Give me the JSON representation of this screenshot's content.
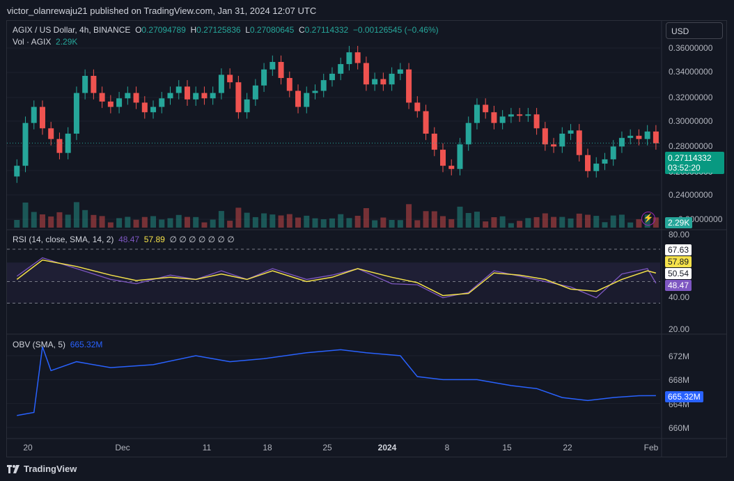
{
  "header": {
    "published": "victor_olanrewaju21 published on TradingView.com, Jan 31, 2024 12:07 UTC"
  },
  "price_legend": {
    "symbol": "AGIX / US Dollar, 4h, BINANCE",
    "o_label": "O",
    "o": "0.27094789",
    "h_label": "H",
    "h": "0.27125836",
    "l_label": "L",
    "l": "0.27080645",
    "c_label": "C",
    "c": "0.27114332",
    "change": "−0.00126545 (−0.46%)",
    "vol_label": "Vol · AGIX",
    "vol": "2.29K"
  },
  "currency": "USD",
  "price_axis": [
    "0.36000000",
    "0.34000000",
    "0.32000000",
    "0.30000000",
    "0.28000000",
    "0.24000000",
    "0.20000000"
  ],
  "price_axis_partial": "0.26000000",
  "last_price": "0.27114332",
  "countdown": "03:52:20",
  "vol_tag": "2.29K",
  "rsi": {
    "label": "RSI (14, close, SMA, 14, 2)",
    "value": "48.47",
    "sma": "57.89",
    "placeholders": "∅ ∅ ∅ ∅ ∅ ∅ ∅",
    "axis": [
      "80.00",
      "40.00",
      "20.00"
    ],
    "tags": {
      "upper": "67.63",
      "sma": "57.89",
      "lower": "50.54",
      "rsi": "48.47"
    }
  },
  "obv": {
    "label": "OBV (SMA, 5)",
    "value": "665.32M",
    "axis": [
      "672M",
      "668M",
      "664M",
      "660M"
    ],
    "tag": "665.32M"
  },
  "time_axis": [
    "20",
    "Dec",
    "11",
    "18",
    "25",
    "2024",
    "8",
    "15",
    "22",
    "Feb"
  ],
  "brand": "TradingView",
  "colors": {
    "up": "#26a69a",
    "down": "#ef5350",
    "rsi": "#7e57c2",
    "rsi_sma": "#f5e24a",
    "obv": "#2962ff",
    "bg": "#131722"
  },
  "chart_data": [
    {
      "type": "candlestick",
      "title": "AGIX / US Dollar, 4h, BINANCE",
      "ylim": [
        0.2,
        0.37
      ],
      "x": [
        "2023-11-17",
        "2023-11-18",
        "2023-11-19",
        "2023-11-20",
        "2023-11-21",
        "2023-11-22",
        "2023-11-23",
        "2023-11-24",
        "2023-11-25",
        "2023-11-26",
        "2023-11-27",
        "2023-11-28",
        "2023-11-29",
        "2023-11-30",
        "2023-12-01",
        "2023-12-02",
        "2023-12-03",
        "2023-12-04",
        "2023-12-05",
        "2023-12-06",
        "2023-12-07",
        "2023-12-08",
        "2023-12-09",
        "2023-12-10",
        "2023-12-11",
        "2023-12-12",
        "2023-12-13",
        "2023-12-14",
        "2023-12-15",
        "2023-12-16",
        "2023-12-17",
        "2023-12-18",
        "2023-12-19",
        "2023-12-20",
        "2023-12-21",
        "2023-12-22",
        "2023-12-23",
        "2023-12-24",
        "2023-12-25",
        "2023-12-26",
        "2023-12-27",
        "2023-12-28",
        "2023-12-29",
        "2023-12-30",
        "2023-12-31",
        "2024-01-01",
        "2024-01-02",
        "2024-01-03",
        "2024-01-04",
        "2024-01-05",
        "2024-01-06",
        "2024-01-07",
        "2024-01-08",
        "2024-01-09",
        "2024-01-10",
        "2024-01-11",
        "2024-01-12",
        "2024-01-13",
        "2024-01-14",
        "2024-01-15",
        "2024-01-16",
        "2024-01-17",
        "2024-01-18",
        "2024-01-19",
        "2024-01-20",
        "2024-01-21",
        "2024-01-22",
        "2024-01-23",
        "2024-01-24",
        "2024-01-25",
        "2024-01-26",
        "2024-01-27",
        "2024-01-28",
        "2024-01-29",
        "2024-01-30",
        "2024-01-31"
      ],
      "close": [
        0.25,
        0.29,
        0.305,
        0.285,
        0.275,
        0.262,
        0.28,
        0.318,
        0.334,
        0.318,
        0.31,
        0.305,
        0.313,
        0.318,
        0.309,
        0.3,
        0.305,
        0.313,
        0.318,
        0.324,
        0.312,
        0.318,
        0.313,
        0.318,
        0.335,
        0.328,
        0.3,
        0.312,
        0.325,
        0.34,
        0.347,
        0.332,
        0.32,
        0.305,
        0.318,
        0.32,
        0.33,
        0.336,
        0.345,
        0.356,
        0.346,
        0.326,
        0.331,
        0.326,
        0.336,
        0.34,
        0.309,
        0.301,
        0.28,
        0.265,
        0.25,
        0.247,
        0.27,
        0.29,
        0.307,
        0.3,
        0.29,
        0.296,
        0.298,
        0.297,
        0.298,
        0.285,
        0.27,
        0.268,
        0.28,
        0.283,
        0.26,
        0.245,
        0.252,
        0.256,
        0.268,
        0.276,
        0.278,
        0.275,
        0.282,
        0.271
      ]
    },
    {
      "type": "line",
      "title": "RSI (14, close, SMA, 14, 2)",
      "ylim": [
        20,
        80
      ],
      "x": [
        "2023-11-17",
        "2023-11-20",
        "2023-11-24",
        "2023-11-28",
        "2023-12-01",
        "2023-12-05",
        "2023-12-08",
        "2023-12-11",
        "2023-12-14",
        "2023-12-17",
        "2023-12-21",
        "2023-12-24",
        "2023-12-27",
        "2023-12-31",
        "2024-01-03",
        "2024-01-06",
        "2024-01-09",
        "2024-01-12",
        "2024-01-15",
        "2024-01-18",
        "2024-01-21",
        "2024-01-24",
        "2024-01-27",
        "2024-01-30",
        "2024-01-31"
      ],
      "series": [
        {
          "values": [
            55,
            72,
            62,
            52,
            48,
            56,
            52,
            60,
            52,
            62,
            52,
            56,
            62,
            48,
            47,
            35,
            40,
            60,
            55,
            50,
            45,
            35,
            57,
            62,
            48.47
          ]
        },
        {
          "values": [
            52,
            70,
            64,
            56,
            51,
            54,
            52,
            57,
            52,
            60,
            50,
            54,
            62,
            54,
            49,
            37,
            39,
            58,
            56,
            52,
            43,
            41,
            52,
            60,
            57.89
          ]
        }
      ]
    },
    {
      "type": "line",
      "title": "OBV (SMA, 5)",
      "ylim": [
        659,
        675
      ],
      "x": [
        "2023-11-17",
        "2023-11-19",
        "2023-11-20",
        "2023-11-21",
        "2023-11-24",
        "2023-11-28",
        "2023-12-03",
        "2023-12-08",
        "2023-12-12",
        "2023-12-16",
        "2023-12-21",
        "2023-12-25",
        "2023-12-28",
        "2024-01-01",
        "2024-01-03",
        "2024-01-06",
        "2024-01-10",
        "2024-01-14",
        "2024-01-17",
        "2024-01-20",
        "2024-01-23",
        "2024-01-26",
        "2024-01-29",
        "2024-01-31"
      ],
      "values": [
        662,
        662.5,
        673.5,
        669.5,
        671,
        670,
        670.5,
        672,
        671,
        671.5,
        672.5,
        673,
        672.5,
        672,
        668.5,
        668,
        668,
        667,
        666.5,
        665,
        664.5,
        665,
        665.3,
        665.32
      ]
    }
  ]
}
